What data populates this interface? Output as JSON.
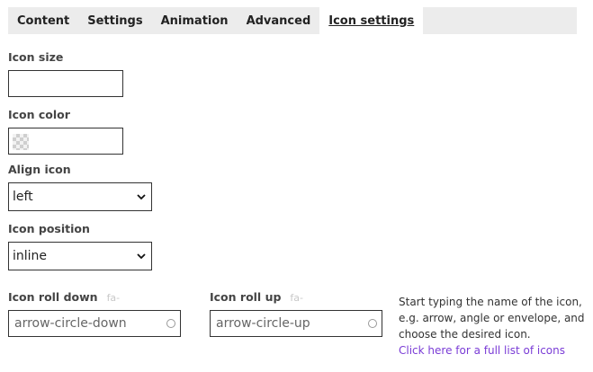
{
  "tabs": [
    {
      "label": "Content"
    },
    {
      "label": "Settings"
    },
    {
      "label": "Animation"
    },
    {
      "label": "Advanced"
    },
    {
      "label": "Icon settings",
      "active": true
    }
  ],
  "icon_size": {
    "label": "Icon size",
    "value": ""
  },
  "icon_color": {
    "label": "Icon color",
    "value": ""
  },
  "align_icon": {
    "label": "Align icon",
    "value": "left"
  },
  "icon_position": {
    "label": "Icon position",
    "value": "inline"
  },
  "roll_down": {
    "label": "Icon roll down",
    "prefix": "fa-",
    "value": "arrow-circle-down"
  },
  "roll_up": {
    "label": "Icon roll up",
    "prefix": "fa-",
    "value": "arrow-circle-up"
  },
  "help": {
    "text": "Start typing the name of the icon, e.g. arrow, angle or envelope, and choose the desired icon.",
    "link": "Click here for a full list of icons"
  },
  "colors": {
    "link": "#7a3cd6",
    "tab_bar": "#ececec"
  }
}
